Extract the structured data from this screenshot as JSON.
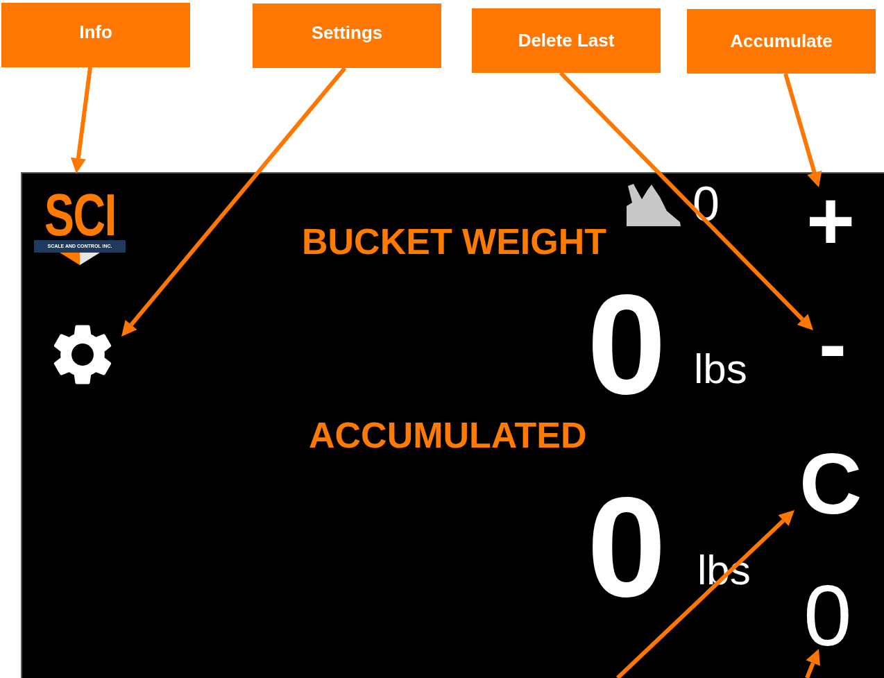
{
  "callouts": [
    {
      "label": "Info"
    },
    {
      "label": "Settings"
    },
    {
      "label": "Delete Last"
    },
    {
      "label": "Accumulate"
    }
  ],
  "screen": {
    "logo": {
      "mark": "SCI",
      "tagline": "SCALE AND CONTROL INC."
    },
    "bucket_count": "0",
    "accumulate_button": "+",
    "delete_last_button": "-",
    "clear_button": "C",
    "load_count": "0",
    "bucket_weight": {
      "heading": "BUCKET WEIGHT",
      "value": "0",
      "unit": "lbs"
    },
    "accumulated": {
      "heading": "ACCUMULATED",
      "value": "0",
      "unit": "lbs"
    }
  }
}
